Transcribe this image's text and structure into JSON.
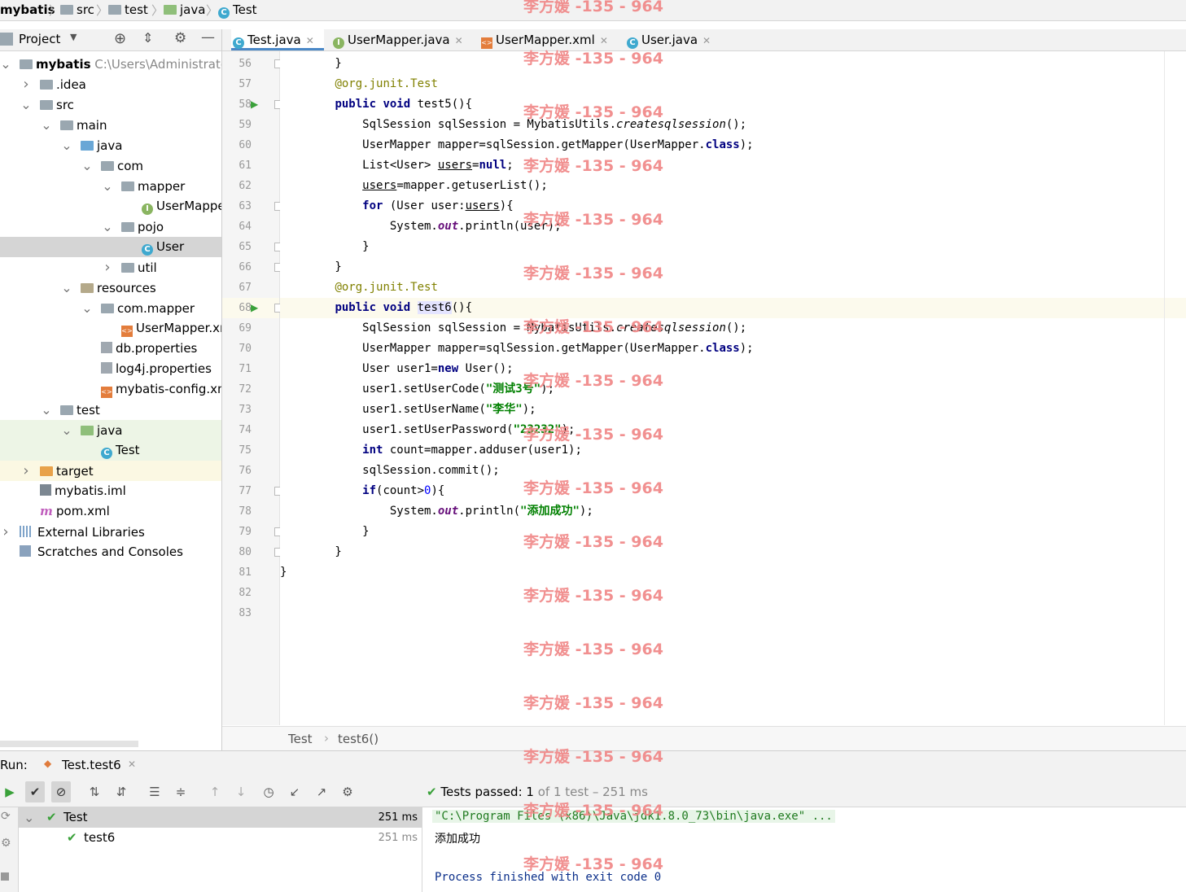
{
  "breadcrumb": [
    "mybatis",
    "src",
    "test",
    "java",
    "Test"
  ],
  "project_panel": {
    "title": "Project",
    "tree": [
      {
        "label": "mybatis",
        "path": "C:\\Users\\Administrator",
        "indent": 0,
        "icon": "module-folder-icon",
        "expanded": "down"
      },
      {
        "label": ".idea",
        "indent": 1,
        "icon": "folder-icon",
        "expanded": "right"
      },
      {
        "label": "src",
        "indent": 1,
        "icon": "folder-icon",
        "expanded": "down"
      },
      {
        "label": "main",
        "indent": 2,
        "icon": "folder-icon",
        "expanded": "down"
      },
      {
        "label": "java",
        "indent": 3,
        "icon": "source-folder-icon",
        "expanded": "down"
      },
      {
        "label": "com",
        "indent": 4,
        "icon": "package-icon",
        "expanded": "down"
      },
      {
        "label": "mapper",
        "indent": 5,
        "icon": "package-icon",
        "expanded": "down"
      },
      {
        "label": "UserMapper",
        "indent": 6,
        "icon": "interface-icon"
      },
      {
        "label": "pojo",
        "indent": 5,
        "icon": "package-icon",
        "expanded": "down"
      },
      {
        "label": "User",
        "indent": 6,
        "icon": "class-icon",
        "selected": true
      },
      {
        "label": "util",
        "indent": 5,
        "icon": "package-icon",
        "expanded": "right"
      },
      {
        "label": "resources",
        "indent": 3,
        "icon": "resources-folder-icon",
        "expanded": "down"
      },
      {
        "label": "com.mapper",
        "indent": 4,
        "icon": "package-icon",
        "expanded": "down"
      },
      {
        "label": "UserMapper.xml",
        "indent": 5,
        "icon": "xml-file-icon"
      },
      {
        "label": "db.properties",
        "indent": 4,
        "icon": "properties-file-icon"
      },
      {
        "label": "log4j.properties",
        "indent": 4,
        "icon": "properties-file-icon"
      },
      {
        "label": "mybatis-config.xml",
        "indent": 4,
        "icon": "xml-file-icon"
      },
      {
        "label": "test",
        "indent": 2,
        "icon": "folder-icon",
        "expanded": "down"
      },
      {
        "label": "java",
        "indent": 3,
        "icon": "test-source-folder-icon",
        "expanded": "down",
        "test": true
      },
      {
        "label": "Test",
        "indent": 4,
        "icon": "class-icon",
        "test": true
      },
      {
        "label": "target",
        "indent": 1,
        "icon": "excluded-folder-icon",
        "expanded": "right",
        "excluded": true
      },
      {
        "label": "mybatis.iml",
        "indent": 1,
        "icon": "iml-file-icon"
      },
      {
        "label": "pom.xml",
        "indent": 1,
        "icon": "maven-icon"
      },
      {
        "label": "External Libraries",
        "indent": 0,
        "icon": "library-icon",
        "expanded": "right"
      },
      {
        "label": "Scratches and Consoles",
        "indent": 0,
        "icon": "scratches-icon"
      }
    ]
  },
  "tabs": [
    {
      "label": "Test.java",
      "icon": "class-icon",
      "active": true
    },
    {
      "label": "UserMapper.java",
      "icon": "interface-icon"
    },
    {
      "label": "UserMapper.xml",
      "icon": "xml-file-icon"
    },
    {
      "label": "User.java",
      "icon": "class-icon"
    }
  ],
  "editor": {
    "first_line": 56,
    "current_line": 68,
    "lines_html": [
      "        }",
      "        <span class=\"ann\">@org.junit.</span><span class=\"ann\">Test</span>",
      "        <span class=\"kw\">public void</span> test5(){",
      "            SqlSession sqlSession = MybatisUtils.<span class=\"it\">createsqlsession</span>();",
      "            UserMapper mapper=sqlSession.getMapper(UserMapper.<span class=\"kw\">class</span>);",
      "            List&lt;User&gt; <span class=\"ul\">users</span>=<span class=\"kw\">null</span>;",
      "            <span class=\"ul\">users</span>=mapper.getuserList();",
      "            <span class=\"kw\">for</span> (User user:<span class=\"ul\">users</span>){",
      "                System.<span class=\"fld\">out</span>.println(user);",
      "            }",
      "        }",
      "        <span class=\"ann\">@org.junit.</span><span class=\"ann\">Test</span>",
      "        <span class=\"kw\">public void</span> <span style=\"background:#e4e4ff\">test6</span>(){",
      "            SqlSession sqlSession = MybatisUtils.<span class=\"it\">createsqlsession</span>();",
      "            UserMapper mapper=sqlSession.getMapper(UserMapper.<span class=\"kw\">class</span>);",
      "            User user1=<span class=\"kw\">new</span> User();",
      "            user1.setUserCode(<span class=\"str\">\"测试3号\"</span>);",
      "            user1.setUserName(<span class=\"str\">\"李华\"</span>);",
      "            user1.setUserPassword(<span class=\"str\">\"23232\"</span>);",
      "            <span class=\"kw\">int</span> count=mapper.adduser(user1);",
      "            sqlSession.commit();",
      "            <span class=\"kw\">if</span>(count&gt;<span class=\"num\">0</span>){",
      "                System.<span class=\"fld\">out</span>.println(<span class=\"str\">\"添加成功\"</span>);",
      "            }",
      "        }",
      "}",
      "",
      ""
    ],
    "run_markers": [
      58,
      68
    ],
    "fold_markers": [
      56,
      58,
      63,
      65,
      66,
      68,
      77,
      79,
      80
    ]
  },
  "editor_breadcrumb": [
    "Test",
    "test6()"
  ],
  "run_panel": {
    "label": "Run:",
    "tab": "Test.test6",
    "status_prefix": "Tests passed:",
    "status_count": "1",
    "status_rest": "of 1 test – 251 ms",
    "tree": [
      {
        "label": "Test",
        "time": "251 ms",
        "indent": 0,
        "selected": true
      },
      {
        "label": "test6",
        "time": "251 ms",
        "indent": 1
      }
    ],
    "console": [
      {
        "text": "\"C:\\Program Files (x86)\\Java\\jdk1.8.0_73\\bin\\java.exe\" ...",
        "color": "#1f7a1f",
        "bg": "#e8f5e8"
      },
      {
        "text": "添加成功",
        "color": "#000000"
      },
      {
        "text": "",
        "color": "#000000"
      },
      {
        "text": "Process finished with exit code 0",
        "color": "#0b2f8a"
      }
    ]
  },
  "watermark": "李方媛 -135 - 964"
}
